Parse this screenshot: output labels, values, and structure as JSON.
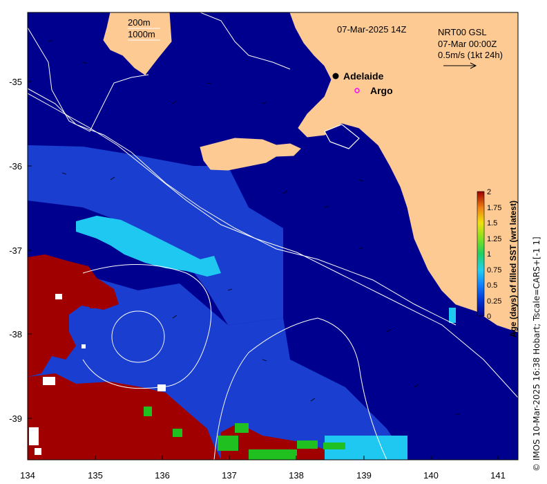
{
  "map": {
    "title_time": "07-Mar-2025 14Z",
    "product": "NRT00 GSL",
    "current_time": "07-Mar 00:00Z",
    "current_scale": "0.5m/s (1kt 24h)",
    "isobath_labels": [
      "200m",
      "1000m"
    ],
    "places": [
      {
        "name": "Adelaide",
        "marker": "black-dot"
      },
      {
        "name": "Argo",
        "marker": "magenta-circle"
      }
    ],
    "x_ticks": [
      "134",
      "135",
      "136",
      "137",
      "138",
      "139",
      "140",
      "141"
    ],
    "y_ticks": [
      "-35",
      "-36",
      "-37",
      "-38",
      "-39"
    ],
    "colorbar": {
      "label": "Age (days) of filled SST (wrt latest)",
      "ticks": [
        "0",
        "0.25",
        "0.5",
        "0.75",
        "1",
        "1.25",
        "1.5",
        "1.75",
        "2"
      ]
    },
    "credit": "© IMOS 10-Mar-2025 16:38 Hobart; Tscale=CARS+[-1 1]",
    "colors": {
      "ocean": "#00008f",
      "land": "#fdca94",
      "old_fill": "#a00000",
      "cyan": "#1fc8f0",
      "green": "#20c020",
      "mid_blue": "#1a3fd0"
    }
  }
}
